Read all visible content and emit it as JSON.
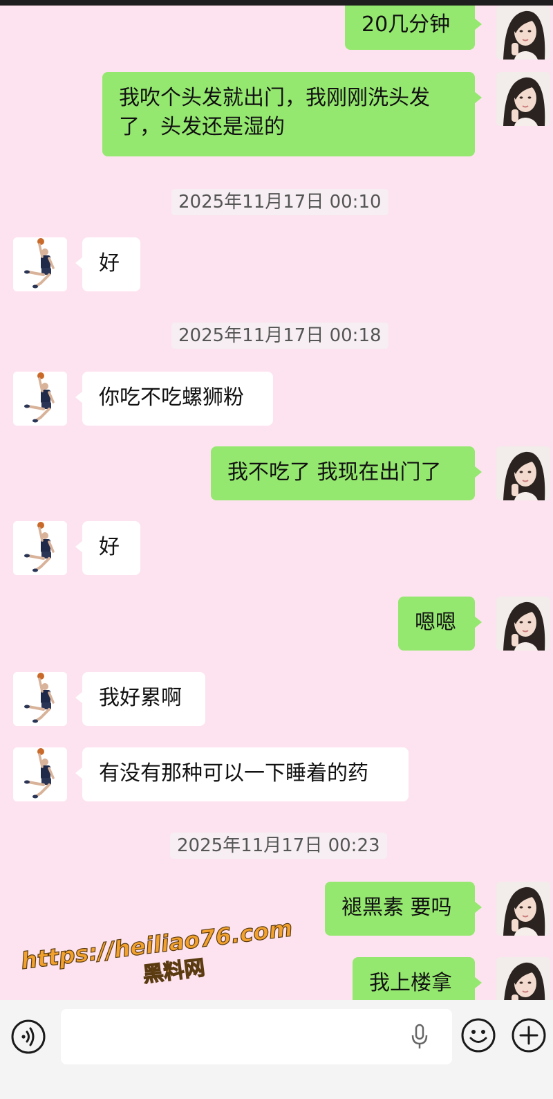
{
  "messages": [
    {
      "sender": "me",
      "text": "20几分钟"
    },
    {
      "sender": "me",
      "text": "我吹个头发就出门，我刚刚洗头发了，头发还是湿的"
    },
    {
      "time": "2025年11月17日 00:10"
    },
    {
      "sender": "other",
      "text": "好"
    },
    {
      "time": "2025年11月17日 00:18"
    },
    {
      "sender": "other",
      "text": "你吃不吃螺狮粉"
    },
    {
      "sender": "me",
      "text": "我不吃了 我现在出门了"
    },
    {
      "sender": "other",
      "text": "好"
    },
    {
      "sender": "me",
      "text": "嗯嗯"
    },
    {
      "sender": "other",
      "text": "我好累啊"
    },
    {
      "sender": "other",
      "text": "有没有那种可以一下睡着的药"
    },
    {
      "time": "2025年11月17日 00:23"
    },
    {
      "sender": "me",
      "text": "褪黑素 要吗"
    },
    {
      "sender": "me",
      "text": "我上楼拿"
    }
  ],
  "watermark": {
    "line1": "https://heiliao76.com",
    "line2": "黑料网",
    "color": "#f2a12c"
  },
  "input_bar": {
    "text_value": "",
    "icons": [
      "voice-toggle-icon",
      "microphone-icon",
      "emoji-icon",
      "plus-icon"
    ]
  },
  "colors": {
    "background": "#fde3ef",
    "my_bubble": "#95e86f",
    "other_bubble": "#ffffff"
  }
}
